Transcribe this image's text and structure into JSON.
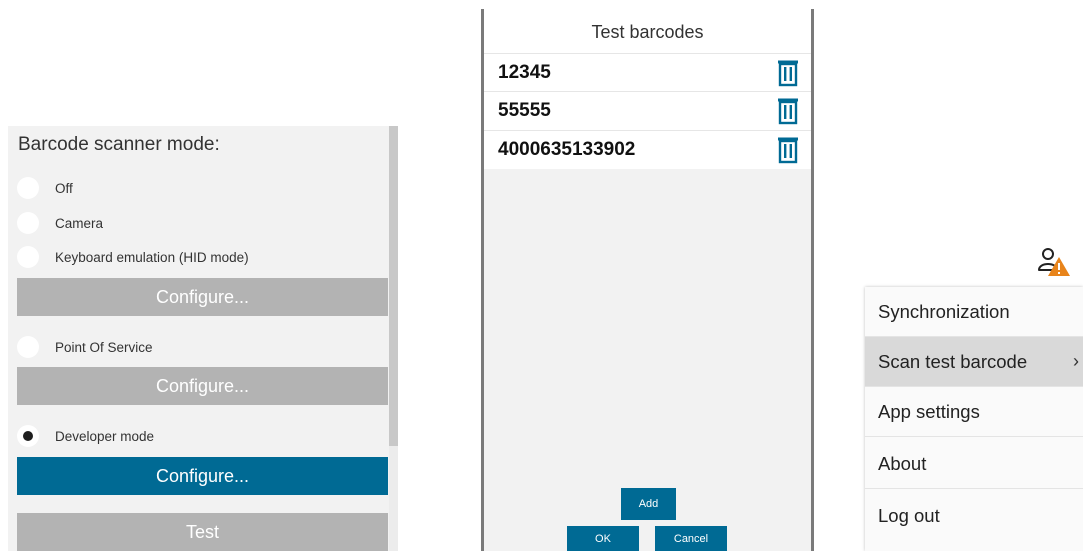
{
  "scanner_settings": {
    "title": "Barcode scanner mode:",
    "options": [
      {
        "label": "Off",
        "selected": false
      },
      {
        "label": "Camera",
        "selected": false
      },
      {
        "label": "Keyboard emulation (HID mode)",
        "selected": false
      },
      {
        "label": "Point Of Service",
        "selected": false
      },
      {
        "label": "Developer mode",
        "selected": true
      }
    ],
    "configure_label": "Configure...",
    "test_label": "Test"
  },
  "test_barcodes_dialog": {
    "title": "Test barcodes",
    "barcodes": [
      "12345",
      "55555",
      "4000635133902"
    ],
    "delete_icon": "trash-icon",
    "add_label": "Add",
    "ok_label": "OK",
    "cancel_label": "Cancel"
  },
  "user_menu": {
    "user_icon": "user-warning-icon",
    "items": [
      {
        "label": "Synchronization",
        "selected": false
      },
      {
        "label": "Scan test barcode",
        "selected": true,
        "has_submenu": true
      },
      {
        "label": "App settings",
        "selected": false
      },
      {
        "label": "About",
        "selected": false
      },
      {
        "label": "Log out",
        "selected": false
      }
    ],
    "submenu_chevron": "›"
  },
  "colors": {
    "accent": "#006a94",
    "disabled_button": "#b3b3b3",
    "panel_background": "#f2f2f2",
    "warning": "#e8841b"
  }
}
